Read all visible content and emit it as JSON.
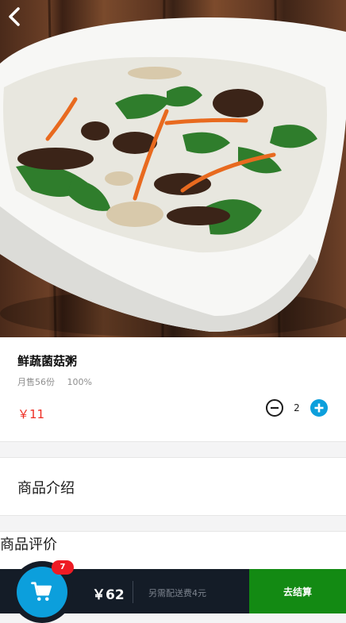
{
  "product": {
    "name": "鲜蔬菌菇粥",
    "monthly_sales": "月售56份",
    "rating": "100%",
    "price": "￥11",
    "quantity": "2"
  },
  "sections": {
    "intro_label": "商品介绍",
    "review_label": "商品评价"
  },
  "cart": {
    "badge_count": "7",
    "total": "￥62",
    "delivery_note": "另需配送费4元",
    "checkout_label": "去结算"
  },
  "icons": {
    "back": "back-arrow-icon",
    "minus": "minus-circle-icon",
    "plus": "plus-circle-icon",
    "cart": "shopping-cart-icon"
  },
  "colors": {
    "price": "#ee2e24",
    "plus_button": "#0c9fdc",
    "cart_bar": "#141c27",
    "checkout": "#138a13",
    "badge": "#ee1b24"
  }
}
